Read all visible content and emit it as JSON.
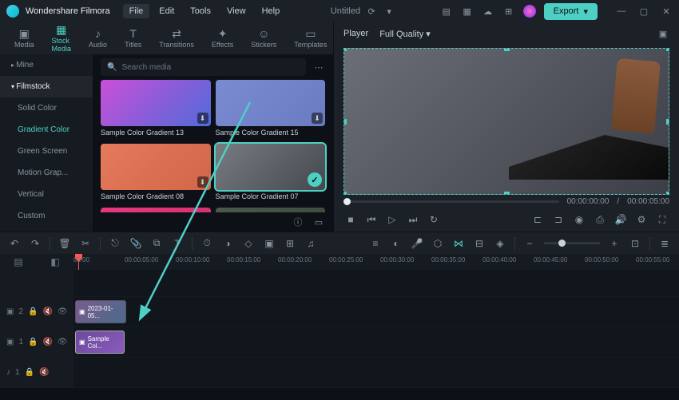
{
  "app": {
    "name": "Wondershare Filmora",
    "title": "Untitled"
  },
  "menu": {
    "file": "File",
    "edit": "Edit",
    "tools": "Tools",
    "view": "View",
    "help": "Help"
  },
  "export": {
    "label": "Export"
  },
  "media_tabs": {
    "media": "Media",
    "stock": "Stock Media",
    "audio": "Audio",
    "titles": "Titles",
    "transitions": "Transitions",
    "effects": "Effects",
    "stickers": "Stickers",
    "templates": "Templates"
  },
  "sidebar": {
    "mine": "Mine",
    "filmstock": "Filmstock",
    "solid": "Solid Color",
    "gradient": "Gradient Color",
    "green": "Green Screen",
    "motion": "Motion Grap...",
    "vertical": "Vertical",
    "custom": "Custom"
  },
  "search": {
    "placeholder": "Search media"
  },
  "thumbs": {
    "g13": "Sample Color Gradient 13",
    "g15": "Sample Color Gradient 15",
    "g08": "Sample Color Gradient 08",
    "g07": "Sample Color Gradient 07"
  },
  "player": {
    "label": "Player",
    "quality": "Full Quality",
    "current": "00:00:00:00",
    "sep": "/",
    "duration": "00:00:05:00"
  },
  "ruler": {
    "t0": "00:00",
    "t1": "00:00:05:00",
    "t2": "00:00:10:00",
    "t3": "00:00:15:00",
    "t4": "00:00:20:00",
    "t5": "00:00:25:00",
    "t6": "00:00:30:00",
    "t7": "00:00:35:00",
    "t8": "00:00:40:00",
    "t9": "00:00:45:00",
    "t10": "00:00:50:00",
    "t11": "00:00:55:00"
  },
  "tracks": {
    "t2": "2",
    "t1": "1",
    "audio": "1",
    "clip1_label": "2023-01-05...",
    "clip2_label": "Sample Col..."
  }
}
